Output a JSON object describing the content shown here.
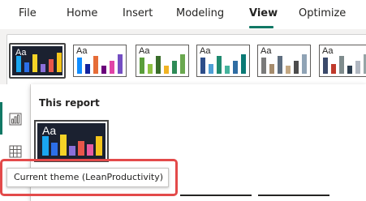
{
  "ribbon": {
    "tabs": [
      {
        "label": "File"
      },
      {
        "label": "Home"
      },
      {
        "label": "Insert"
      },
      {
        "label": "Modeling"
      },
      {
        "label": "View",
        "active": true
      },
      {
        "label": "Optimize"
      }
    ],
    "accent_color": "#117865"
  },
  "themes_gallery": {
    "swatch_text": "Aa",
    "items": [
      {
        "style": "dark",
        "selected": true,
        "bar_colors": [
          "#1aa6f0",
          "#2c6fe8",
          "#f5d327",
          "#8a6fd8",
          "#e8564a",
          "#f5c51b"
        ]
      },
      {
        "style": "light",
        "bar_colors": [
          "#118dff",
          "#12239e",
          "#e66c37",
          "#6b007b",
          "#e044a7",
          "#744ec2"
        ]
      },
      {
        "style": "light",
        "bar_colors": [
          "#5a9e3a",
          "#8fc142",
          "#3a6e2a",
          "#f0b323",
          "#2e8b57",
          "#6aa84f"
        ]
      },
      {
        "style": "light",
        "bar_colors": [
          "#2d4e8a",
          "#4f9fd6",
          "#1f8a70",
          "#45b39d",
          "#2f6da3",
          "#0b7a75"
        ]
      },
      {
        "style": "light",
        "bar_colors": [
          "#7a7a7a",
          "#a68c6d",
          "#5e6e80",
          "#c4a882",
          "#4c4c4c",
          "#8fa3b5"
        ]
      },
      {
        "style": "light",
        "bar_colors": [
          "#3b4a6b",
          "#c0392b",
          "#7f8c8d",
          "#2c3e50",
          "#b0b7c1",
          "#95a5a6"
        ]
      }
    ]
  },
  "this_report": {
    "title": "This report",
    "theme": {
      "swatch_text": "Aa",
      "bar_colors": [
        "#1aa6f0",
        "#2c6fe8",
        "#f5d327",
        "#8a6fd8",
        "#e8564a",
        "#e85aa0",
        "#f5c51b"
      ]
    }
  },
  "tooltip": {
    "text": "Current theme (LeanProductivity)"
  },
  "rail_icons": [
    "bar-chart-icon",
    "table-icon"
  ]
}
